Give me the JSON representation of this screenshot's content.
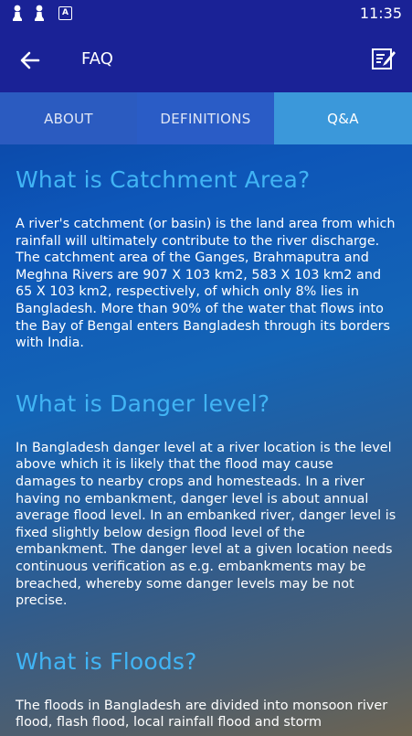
{
  "status_bar": {
    "time": "11:35",
    "icons": [
      "pawn-icon",
      "pawn-icon",
      "a-box-icon"
    ],
    "a_label": "A"
  },
  "app_bar": {
    "title": "FAQ",
    "back_icon": "arrow-left-icon",
    "action_icon": "edit-note-icon"
  },
  "tabs": [
    {
      "label": "ABOUT",
      "selected": false
    },
    {
      "label": "DEFINITIONS",
      "selected": false
    },
    {
      "label": "Q&A",
      "selected": true
    }
  ],
  "colors": {
    "app_bar": "#1a2296",
    "question_text": "#41b4f4",
    "selected_tab": "#3b98da"
  },
  "faq": [
    {
      "question": "What is Catchment Area?",
      "answer": "A river's catchment (or basin) is the land area from which rainfall will ultimately contribute to the river discharge. The catchment area of the Ganges, Brahmaputra and Meghna Rivers are 907 X 103 km2, 583 X 103 km2 and 65 X 103 km2, respectively, of which only 8% lies in Bangladesh. More than 90% of the water that flows into the Bay of Bengal enters Bangladesh through its borders with India."
    },
    {
      "question": "What is Danger level?",
      "answer": "In Bangladesh danger level at a river location is the level above which it is likely that the flood may cause damages to nearby crops and homesteads. In a river having no embankment, danger level is about annual average flood level. In an embanked river, danger level is fixed slightly below design flood level of the embankment. The danger level at a given location needs continuous verification as e.g. embankments may be breached, whereby some danger levels may be not precise."
    },
    {
      "question": "What is Floods?",
      "answer": "The floods in Bangladesh are divided into monsoon river flood, flash flood, local rainfall flood and storm"
    }
  ]
}
